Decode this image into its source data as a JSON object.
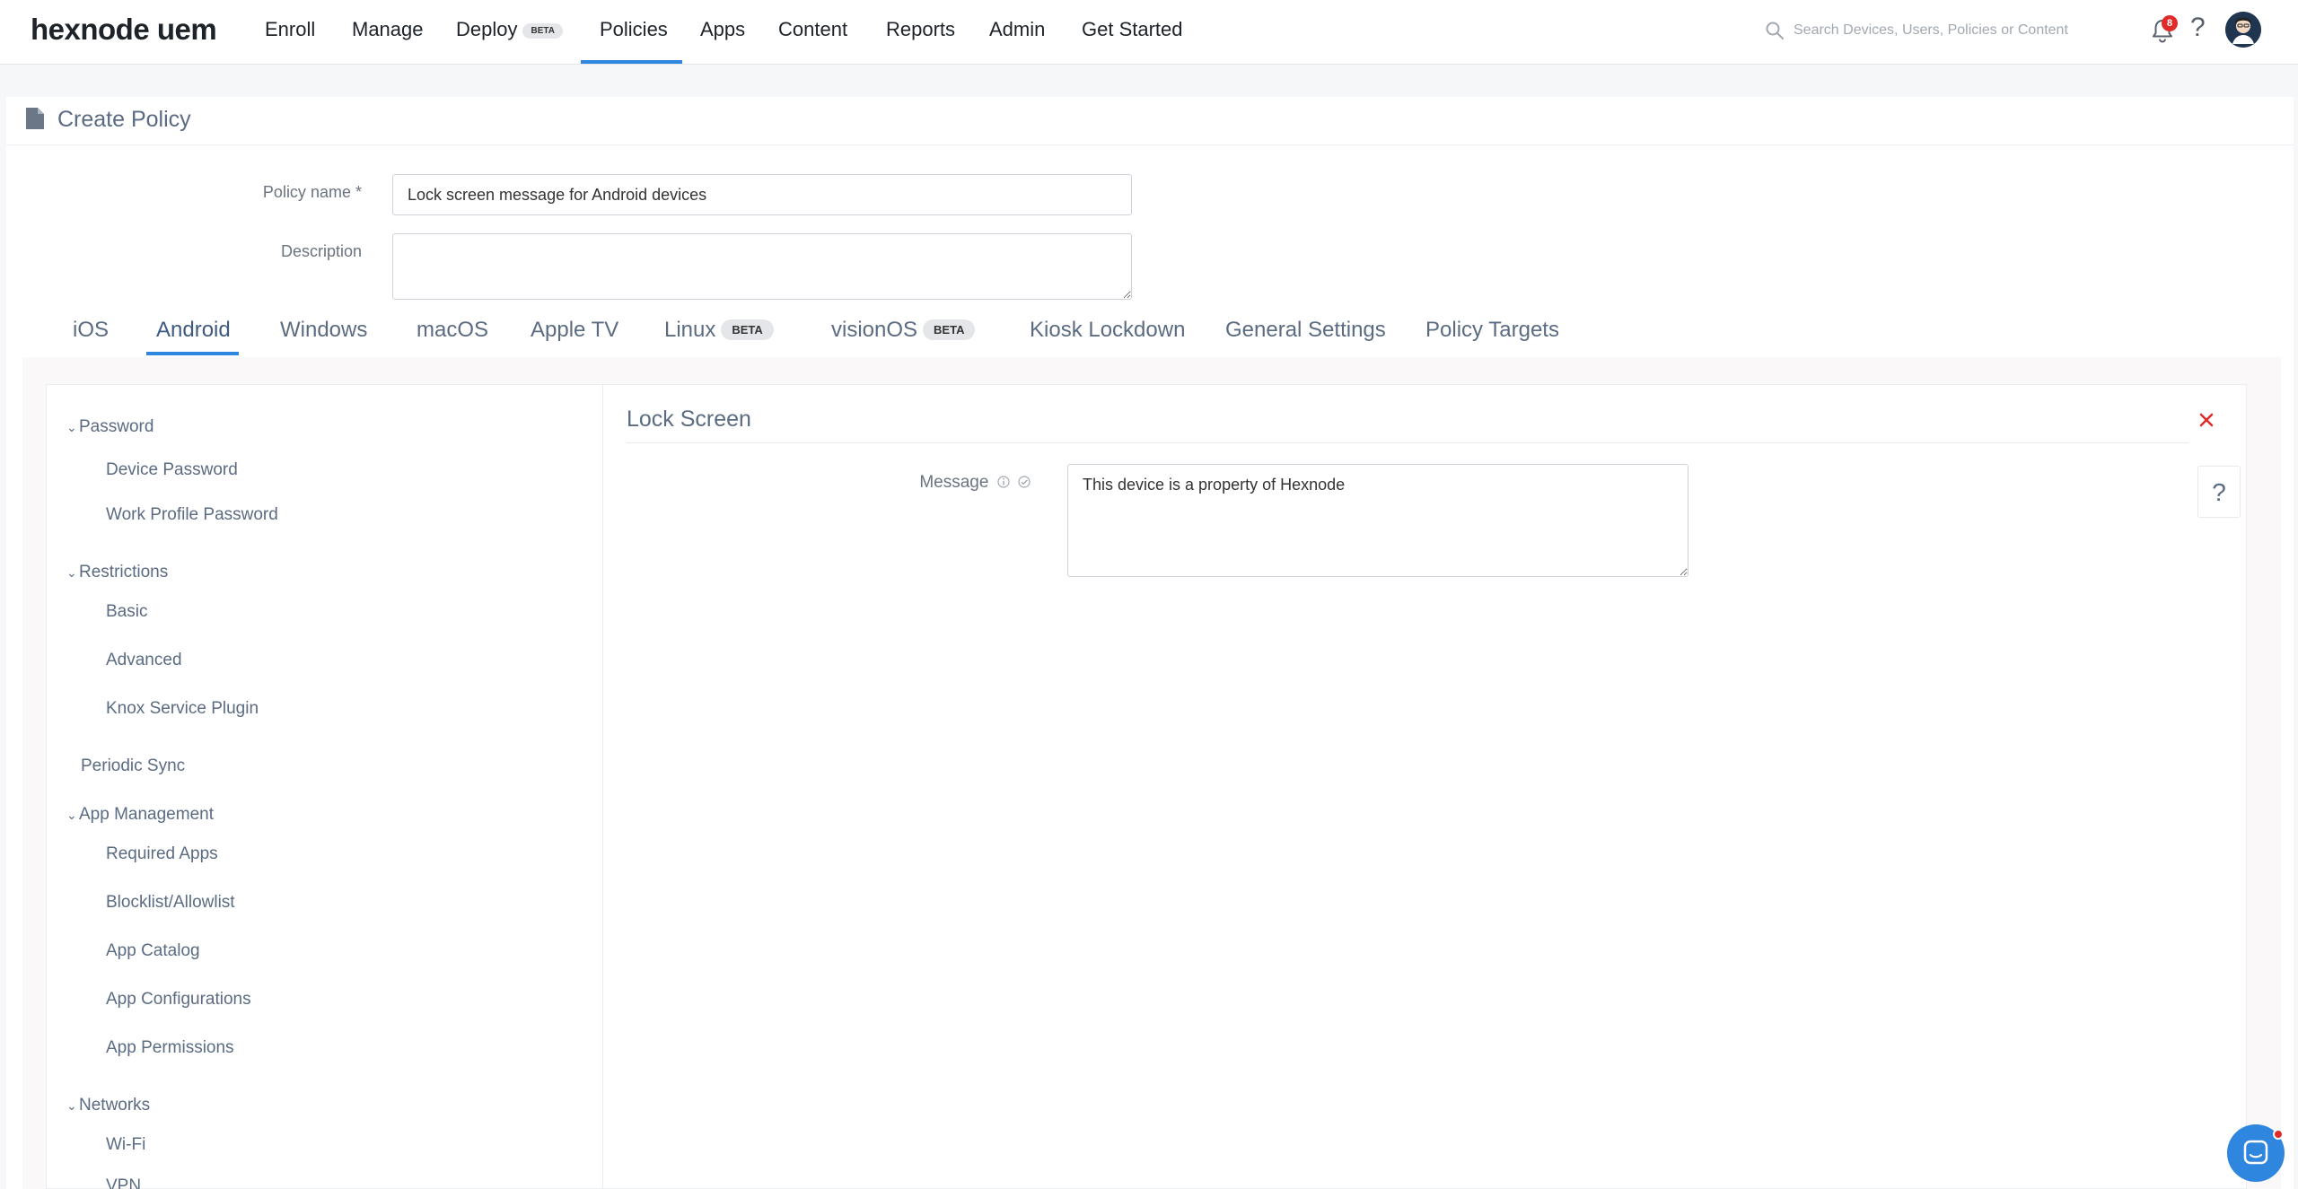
{
  "brand": {
    "logo": "hexnode uem"
  },
  "nav": {
    "items": [
      {
        "label": "Enroll"
      },
      {
        "label": "Manage"
      },
      {
        "label": "Deploy",
        "badge": "BETA"
      },
      {
        "label": "Policies"
      },
      {
        "label": "Apps"
      },
      {
        "label": "Content"
      },
      {
        "label": "Reports"
      },
      {
        "label": "Admin"
      },
      {
        "label": "Get Started"
      }
    ],
    "active": "Policies",
    "search_placeholder": "Search Devices, Users, Policies or Content",
    "notification_count": "8",
    "help": "?"
  },
  "page": {
    "title": "Create Policy",
    "policy_name_label": "Policy name",
    "required_mark": "*",
    "policy_name_value": "Lock screen message for Android devices",
    "description_label": "Description",
    "description_value": ""
  },
  "tabs": [
    {
      "label": "iOS"
    },
    {
      "label": "Android"
    },
    {
      "label": "Windows"
    },
    {
      "label": "macOS"
    },
    {
      "label": "Apple TV"
    },
    {
      "label": "Linux",
      "badge": "BETA"
    },
    {
      "label": "visionOS",
      "badge": "BETA"
    },
    {
      "label": "Kiosk Lockdown"
    },
    {
      "label": "General Settings"
    },
    {
      "label": "Policy Targets"
    }
  ],
  "active_tab": "Android",
  "sidebar": {
    "groups": [
      {
        "label": "Password",
        "items": [
          "Device Password",
          "Work Profile Password"
        ]
      },
      {
        "label": "Restrictions",
        "items": [
          "Basic",
          "Advanced",
          "Knox Service Plugin"
        ]
      },
      {
        "label": "Periodic Sync",
        "items": []
      },
      {
        "label": "App Management",
        "items": [
          "Required Apps",
          "Blocklist/Allowlist",
          "App Catalog",
          "App Configurations",
          "App Permissions"
        ]
      },
      {
        "label": "Networks",
        "items": [
          "Wi-Fi",
          "VPN"
        ]
      }
    ]
  },
  "section": {
    "title": "Lock Screen",
    "message_label": "Message",
    "message_value": "This device is a property of Hexnode",
    "help_label": "?"
  },
  "colors": {
    "accent": "#2e86de",
    "text_muted": "#5b6b82",
    "danger": "#e02b2b"
  }
}
